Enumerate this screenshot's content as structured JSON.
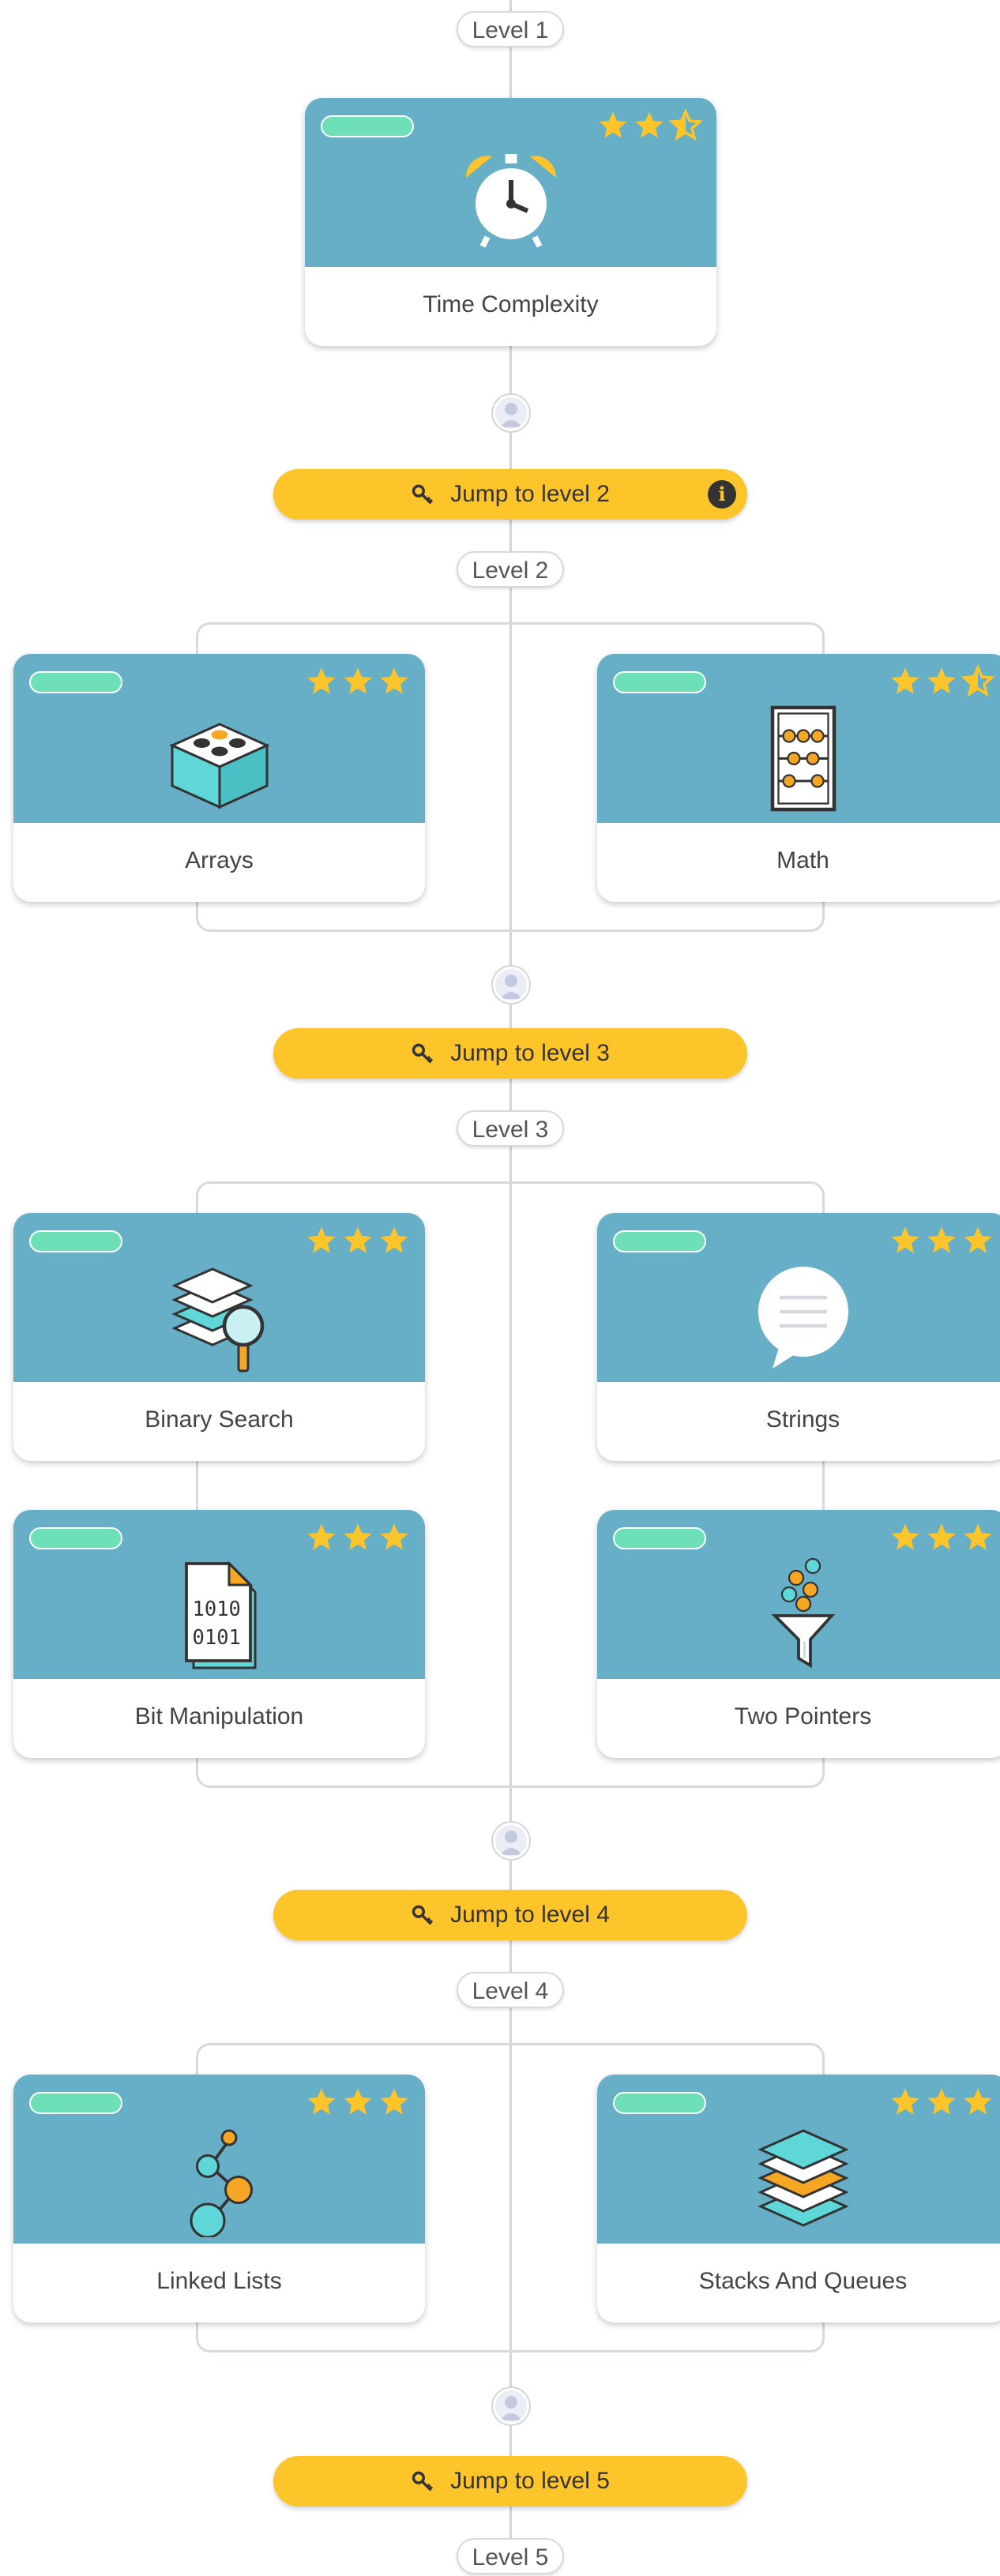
{
  "levels": [
    {
      "label": "Level 1"
    },
    {
      "label": "Level 2"
    },
    {
      "label": "Level 3"
    },
    {
      "label": "Level 4"
    },
    {
      "label": "Level 5"
    }
  ],
  "jumps": [
    {
      "label": "Jump to level 2",
      "info_icon": "info-icon",
      "info_text": "i"
    },
    {
      "label": "Jump to level 3"
    },
    {
      "label": "Jump to level 4"
    },
    {
      "label": "Jump to level 5"
    }
  ],
  "cards": [
    {
      "title": "Time Complexity",
      "icon": "alarm-clock-icon",
      "rating": 2.5
    },
    {
      "title": "Arrays",
      "icon": "lego-brick-icon",
      "rating": 3
    },
    {
      "title": "Math",
      "icon": "abacus-icon",
      "rating": 2.5
    },
    {
      "title": "Binary Search",
      "icon": "magnifier-stack-icon",
      "rating": 3
    },
    {
      "title": "Strings",
      "icon": "speech-bubble-icon",
      "rating": 3
    },
    {
      "title": "Bit Manipulation",
      "icon": "binary-document-icon",
      "rating": 3
    },
    {
      "title": "Two Pointers",
      "icon": "funnel-icon",
      "rating": 3
    },
    {
      "title": "Linked Lists",
      "icon": "linked-nodes-icon",
      "rating": 3
    },
    {
      "title": "Stacks And Queues",
      "icon": "layers-icon",
      "rating": 3
    }
  ],
  "colors": {
    "card_top": "#66afc6",
    "progress_pill": "#6ee0b8",
    "star": "#fdc52a",
    "jump_button": "#fdc52a",
    "connector": "#d3d5d9"
  }
}
